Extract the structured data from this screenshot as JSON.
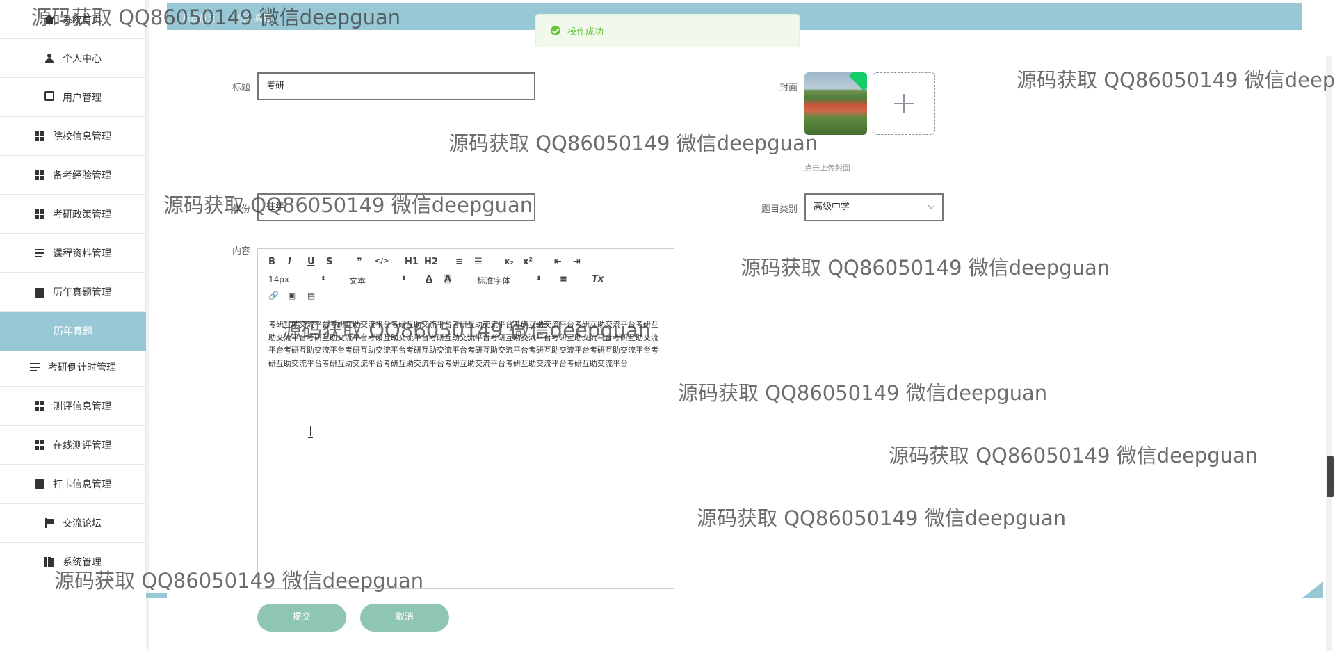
{
  "topbar": {
    "crumb_1": "系统首页",
    "crumb_2": "历年真题"
  },
  "sidebar": {
    "items": [
      {
        "label": "系统首页",
        "icon": "home-icon"
      },
      {
        "label": "个人中心",
        "icon": "user-icon"
      },
      {
        "label": "用户管理",
        "icon": "monitor-icon"
      },
      {
        "label": "院校信息管理",
        "icon": "grid-icon"
      },
      {
        "label": "备考经验管理",
        "icon": "grid-icon"
      },
      {
        "label": "考研政策管理",
        "icon": "grid-icon"
      },
      {
        "label": "课程资料管理",
        "icon": "list-icon"
      },
      {
        "label": "历年真题管理",
        "icon": "bag-icon"
      },
      {
        "label": "历年真题",
        "icon": "",
        "active": true
      },
      {
        "label": "考研倒计时管理",
        "icon": "list-icon"
      },
      {
        "label": "测评信息管理",
        "icon": "grid-icon"
      },
      {
        "label": "在线测评管理",
        "icon": "grid-icon"
      },
      {
        "label": "打卡信息管理",
        "icon": "clipboard-icon"
      },
      {
        "label": "交流论坛",
        "icon": "flag-icon"
      },
      {
        "label": "系统管理",
        "icon": "book-icon"
      }
    ]
  },
  "toast": {
    "message": "操作成功",
    "color": "#67c23a"
  },
  "form": {
    "title_label": "标题",
    "title_value": "考研",
    "cover_label": "封面",
    "cover_tip": "点击上传封面",
    "year_label": "年份",
    "year_value": "往年",
    "category_label": "题目类别",
    "category_value": "高级中学",
    "content_label": "内容",
    "content_text": "考研互助交流平台考研互助交流平台考研互助交流平台考研互助交流平台考研互助交流平台考研互助交流平台考研互助交流平台考研互助交流平台考研互助交流平台考研互助交流平台考研互助交流平台考研互助交流平台考研互助交流平台考研互助交流平台考研互助交流平台考研互助交流平台考研互助交流平台考研互助交流平台考研互助交流平台考研互助交流平台考研互助交流平台考研互助交流平台考研互助交流平台考研互助交流平台考研互助交流平台"
  },
  "editor": {
    "font_size": "14px",
    "format": "文本",
    "font_family": "标准字体",
    "buttons": [
      "B",
      "I",
      "U",
      "S",
      "❞",
      "</>",
      "H1",
      "H2",
      "≡",
      "☰",
      "x₂",
      "x²",
      "⇤",
      "⇥",
      "A",
      "A",
      "≡",
      "Tx",
      "🔗",
      "▣",
      "▤"
    ]
  },
  "actions": {
    "submit": "提交",
    "cancel": "取消"
  },
  "watermark": "源码获取 QQ86050149 微信deepguan",
  "colors": {
    "accent": "#98c8d6",
    "button": "#8fc5b4"
  }
}
